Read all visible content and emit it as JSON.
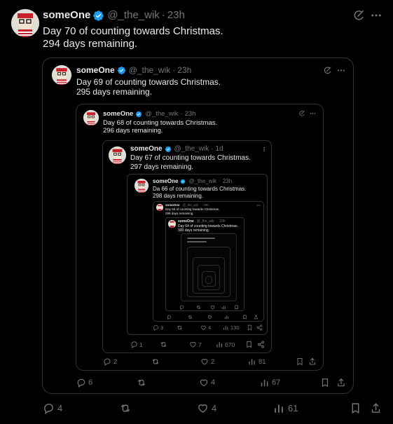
{
  "tweet": {
    "name": "someOne",
    "handle": "@_the_wik",
    "sep": "·",
    "time": "23h",
    "line1": "Day 70 of counting towards Christmas.",
    "line2": "294 days remaining.",
    "replies": "4",
    "reposts": "",
    "likes": "4",
    "views": "61"
  },
  "quote1": {
    "name": "someOne",
    "handle": "@_the_wik",
    "sep": "·",
    "time": "23h",
    "line1": "Day 69 of counting towards Christmas.",
    "line2": "295 days remaining.",
    "replies": "6",
    "likes": "4",
    "views": "67"
  },
  "quote2": {
    "name": "someOne",
    "handle": "@_the_wik",
    "sep": "·",
    "time": "23h",
    "line1": "Day 68 of counting towards Christmas.",
    "line2": "296 days remaining.",
    "replies": "2",
    "likes": "2",
    "views": "81"
  },
  "quote3": {
    "name": "someOne",
    "handle": "@_the_wik",
    "sep": "·",
    "time": "1d",
    "line1": "Day 67 of counting towards Christmas.",
    "line2": "297 days remaining.",
    "replies": "1",
    "likes": "7",
    "views": "670"
  },
  "quote4": {
    "name": "someOne",
    "handle": "@_the_wik",
    "sep": "·",
    "time": "23h",
    "line1": "Da 66 of counting towards Christmas.",
    "line2": "298 days remaining.",
    "replies": "3",
    "likes": "4",
    "views": "130"
  },
  "quote5": {
    "name": "someOne",
    "handle": "@_the_wik",
    "sep": "·",
    "time": "23h",
    "line1": "Day 65 of counting towards Christmas.",
    "line2": "299 days remaining."
  },
  "quote6": {
    "name": "someOne",
    "handle": "@_the_wik",
    "sep": "·",
    "time": "23h",
    "line1": "Day 64 of counting towards Christmas.",
    "line2": "300 days remaining."
  },
  "colors": {
    "background": "#000000",
    "text": "#e7e9ea",
    "muted": "#71767b",
    "border": "#2f3336",
    "verified": "#1d9bf0"
  }
}
